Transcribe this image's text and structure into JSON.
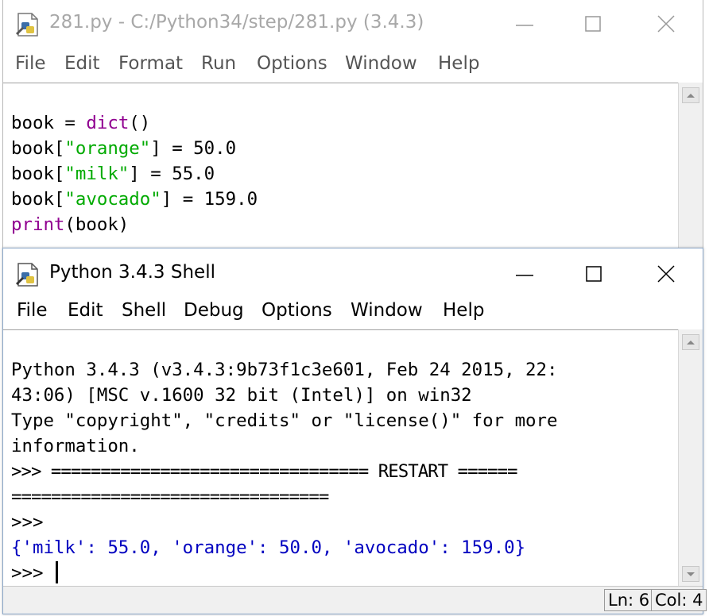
{
  "editor": {
    "title": "281.py - C:/Python34/step/281.py (3.4.3)",
    "menu": [
      "File",
      "Edit",
      "Format",
      "Run",
      "Options",
      "Window",
      "Help"
    ],
    "code": [
      [
        "book = ",
        "dict",
        "()"
      ],
      [
        "book[",
        "\"orange\"",
        "] = 50.0"
      ],
      [
        "book[",
        "\"milk\"",
        "] = 55.0"
      ],
      [
        "book[",
        "\"avocado\"",
        "] = 159.0"
      ],
      [
        "print",
        "(book)"
      ]
    ]
  },
  "shell": {
    "title": "Python 3.4.3 Shell",
    "menu": [
      "File",
      "Edit",
      "Shell",
      "Debug",
      "Options",
      "Window",
      "Help"
    ],
    "lines": [
      "Python 3.4.3 (v3.4.3:9b73f1c3e601, Feb 24 2015, 22:",
      "43:06) [MSC v.1600 32 bit (Intel)] on win32",
      "Type \"copyright\", \"credits\" or \"license()\" for more",
      "information.",
      ">>> ================================ RESTART ======",
      "================================",
      ">>> ",
      "{'milk': 55.0, 'orange': 50.0, 'avocado': 159.0}",
      ">>> "
    ],
    "status": {
      "line": "Ln: 6",
      "col": "Col: 4"
    }
  },
  "icons": [
    "python-file-icon",
    "minimize-icon",
    "maximize-icon",
    "close-icon"
  ],
  "colors": {
    "builtin": "#900090",
    "string": "#00aa00",
    "output": "#0000c0",
    "window_border_active": "#8aa6c8"
  }
}
